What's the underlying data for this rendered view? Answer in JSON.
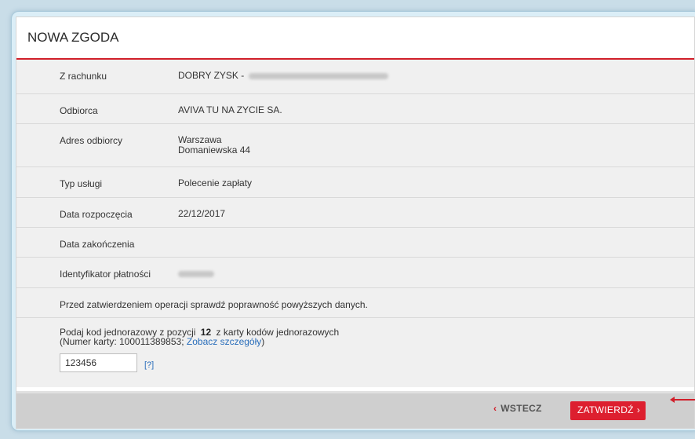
{
  "title": "NOWA ZGODA",
  "rows": [
    {
      "label": "Z rachunku",
      "value": "DOBRY ZYSK -"
    },
    {
      "label": "Odbiorca",
      "value": "AVIVA TU NA ZYCIE SA."
    },
    {
      "label": "Adres odbiorcy",
      "value_line1": "Warszawa",
      "value_line2": "Domaniewska 44"
    },
    {
      "label": "Typ usługi",
      "value": "Polecenie zapłaty"
    },
    {
      "label": "Data rozpoczęcia",
      "value": "22/12/2017"
    },
    {
      "label": "Data zakończenia",
      "value": ""
    },
    {
      "label": "Identyfikator płatności",
      "value": ""
    }
  ],
  "notice": "Przed zatwierdzeniem operacji sprawdź poprawność powyższych danych.",
  "otp": {
    "prefix": "Podaj kod jednorazowy z pozycji",
    "position": "12",
    "suffix": "z karty kodów jednorazowych",
    "card_prefix": "(Numer karty: 100011389853;",
    "details_link": "Zobacz szczegóły",
    "card_suffix": ")",
    "input_value": "123456",
    "help_link": "[?]"
  },
  "footer": {
    "back_chevron": "‹",
    "back_label": "WSTECZ",
    "confirm_label": "ZATWIERDŹ",
    "confirm_chevron": "›"
  },
  "colors": {
    "accent": "#dd1f2f",
    "link": "#2a6ebb",
    "background": "#c9dde8"
  }
}
